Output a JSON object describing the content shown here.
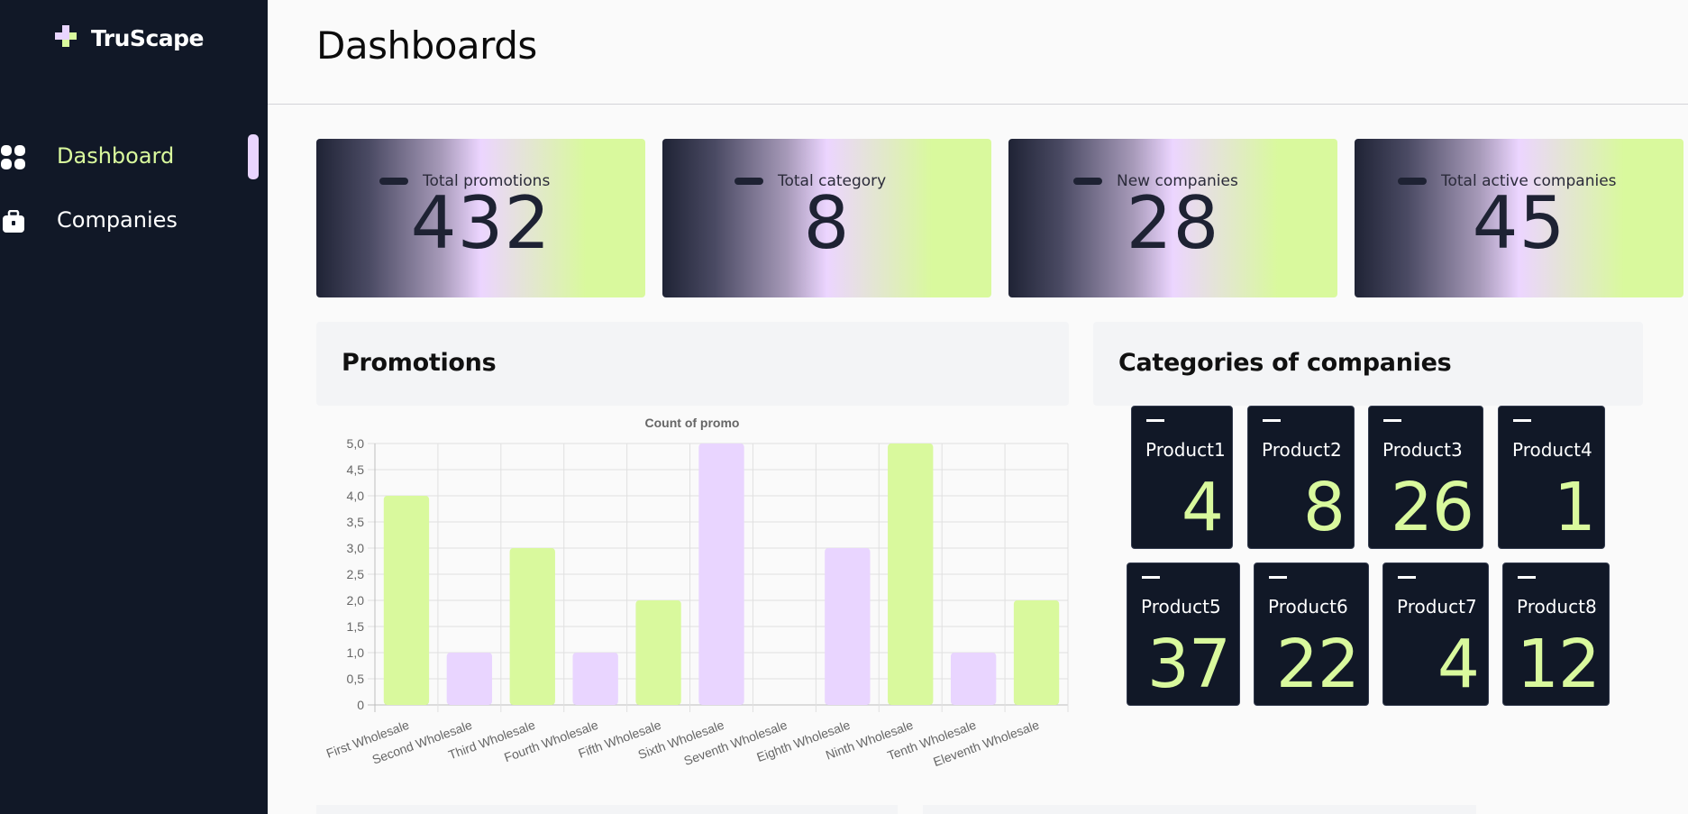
{
  "app": {
    "name": "TruScape"
  },
  "sidebar": {
    "items": [
      {
        "label": "Dashboard",
        "icon": "grid-icon",
        "active": true
      },
      {
        "label": "Companies",
        "icon": "briefcase-icon",
        "active": false
      }
    ]
  },
  "header": {
    "title": "Dashboards"
  },
  "stats": [
    {
      "label": "Total promotions",
      "value": "432"
    },
    {
      "label": "Total category",
      "value": "8"
    },
    {
      "label": "New companies",
      "value": "28"
    },
    {
      "label": "Total active companies",
      "value": "45"
    }
  ],
  "promotions_panel": {
    "title": "Promotions"
  },
  "categories_panel": {
    "title": "Categories of companies"
  },
  "categories": [
    {
      "name": "Product1",
      "value": "4"
    },
    {
      "name": "Product2",
      "value": "8"
    },
    {
      "name": "Product3",
      "value": "26"
    },
    {
      "name": "Product4",
      "value": "1"
    },
    {
      "name": "Product5",
      "value": "37"
    },
    {
      "name": "Product6",
      "value": "22"
    },
    {
      "name": "Product7",
      "value": "4"
    },
    {
      "name": "Product8",
      "value": "12"
    }
  ],
  "colors": {
    "sidebar": "#111827",
    "accent_green": "#d9f99d",
    "accent_purple": "#e9d5ff"
  },
  "chart_data": {
    "type": "bar",
    "title": "Count of promo",
    "categories": [
      "First Wholesale",
      "Second Wholesale",
      "Third Wholesale",
      "Fourth Wholesale",
      "Fifth Wholesale",
      "Sixth Wholesale",
      "Seventh Wholesale",
      "Eighth Wholesale",
      "Ninth Wholesale",
      "Tenth Wholesale",
      "Eleventh Wholesale"
    ],
    "values": [
      4,
      1,
      3,
      1,
      2,
      5,
      0,
      3,
      5,
      1,
      2
    ],
    "bar_colors": [
      "#d9f99d",
      "#e9d5ff",
      "#d9f99d",
      "#e9d5ff",
      "#d9f99d",
      "#e9d5ff",
      "#d9f99d",
      "#e9d5ff",
      "#d9f99d",
      "#e9d5ff",
      "#d9f99d"
    ],
    "ylim": [
      0,
      5
    ],
    "yticks": [
      "0",
      "0,5",
      "1,0",
      "1,5",
      "2,0",
      "2,5",
      "3,0",
      "3,5",
      "4,0",
      "4,5",
      "5,0"
    ],
    "grid": true,
    "xlabel": "",
    "ylabel": ""
  }
}
